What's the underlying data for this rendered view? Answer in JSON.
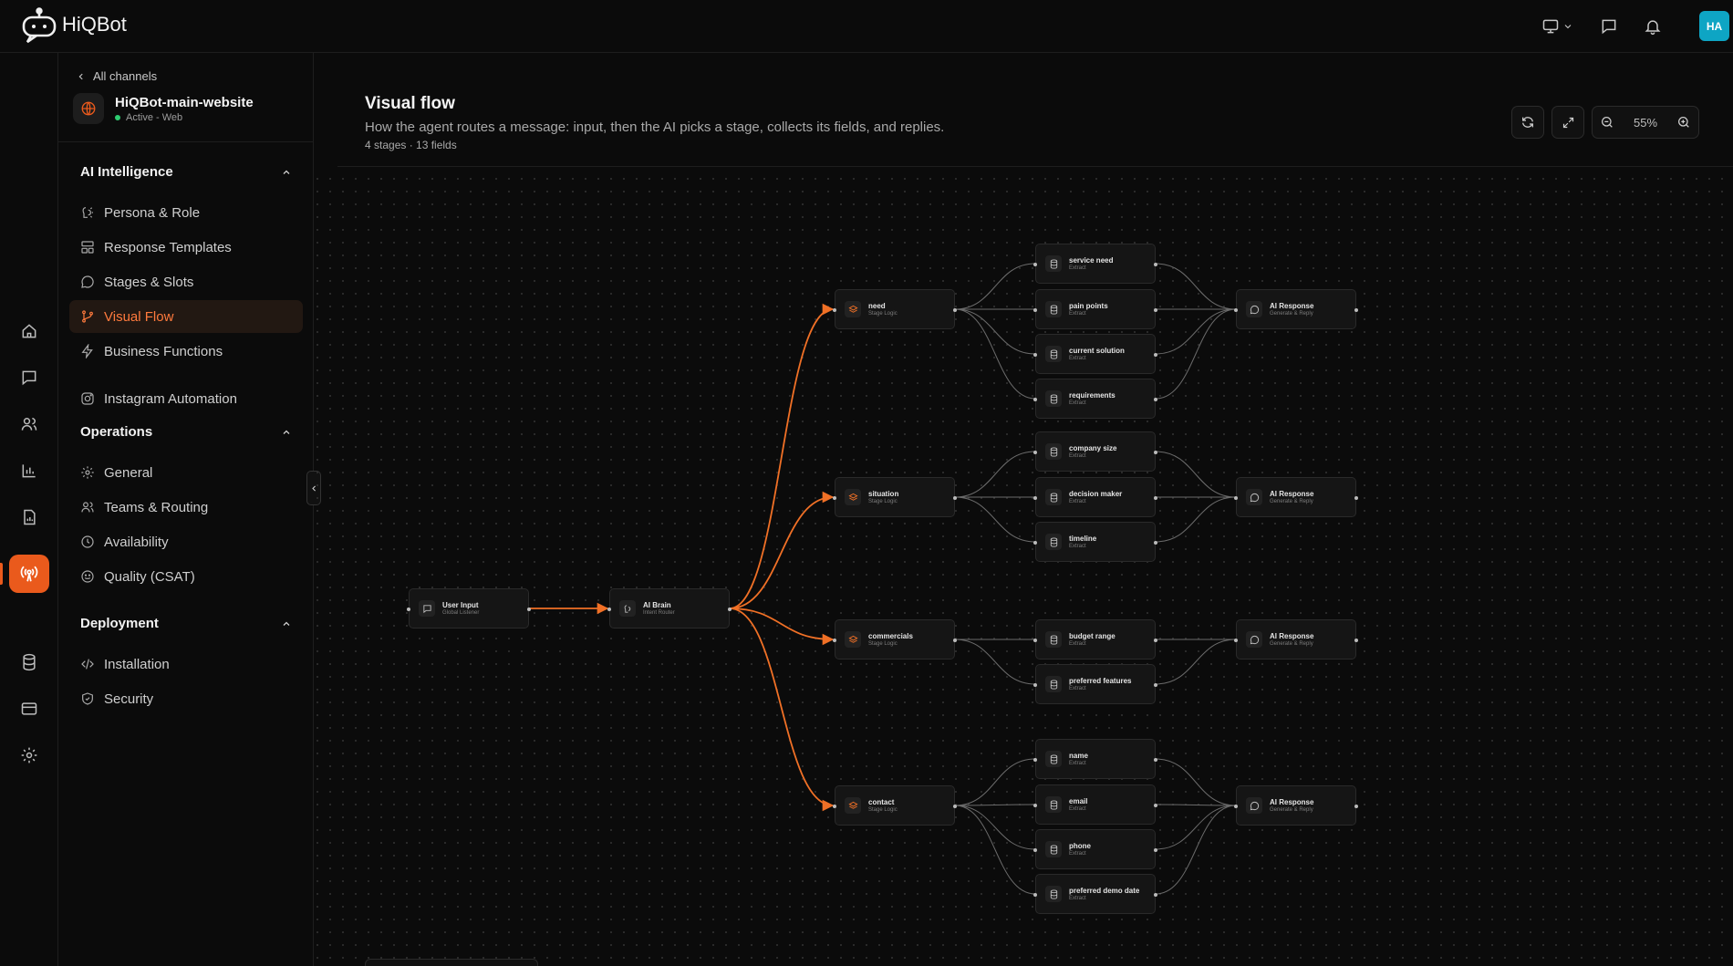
{
  "app": {
    "name": "HiQBot",
    "avatar_initials": "HA",
    "accent": "#ea5a1c",
    "avatar_color": "#0ea5c4"
  },
  "topbar": {
    "icons": [
      "monitor-icon",
      "chevron-down-icon",
      "message-icon",
      "bell-icon"
    ]
  },
  "rail": {
    "items": [
      "home-icon",
      "chat-icon",
      "users-icon",
      "bar-chart-icon",
      "report-icon",
      "broadcast-icon",
      "database-icon",
      "card-icon",
      "settings-icon"
    ],
    "active": "broadcast-icon"
  },
  "sidebar": {
    "back_label": "All channels",
    "channel": {
      "name": "HiQBot-main-website",
      "status": "Active - Web"
    },
    "sections": {
      "ai": {
        "title": "AI Intelligence",
        "items": [
          {
            "label": "Persona & Role",
            "icon": "persona-icon"
          },
          {
            "label": "Response Templates",
            "icon": "template-icon"
          },
          {
            "label": "Stages & Slots",
            "icon": "chat-bubble-icon"
          },
          {
            "label": "Visual Flow",
            "icon": "branch-icon",
            "active": true
          },
          {
            "label": "Business Functions",
            "icon": "bolt-icon"
          },
          {
            "label": "Instagram Automation",
            "icon": "instagram-icon"
          }
        ]
      },
      "operations": {
        "title": "Operations",
        "items": [
          {
            "label": "General",
            "icon": "gear-icon"
          },
          {
            "label": "Teams & Routing",
            "icon": "team-icon"
          },
          {
            "label": "Availability",
            "icon": "clock-icon"
          },
          {
            "label": "Quality (CSAT)",
            "icon": "smile-icon"
          }
        ]
      },
      "deployment": {
        "title": "Deployment",
        "items": [
          {
            "label": "Installation",
            "icon": "code-icon"
          },
          {
            "label": "Security",
            "icon": "shield-icon"
          }
        ]
      }
    }
  },
  "header": {
    "title": "Visual flow",
    "description": "How the agent routes a message: input, then the AI picks a stage, collects its fields, and replies.",
    "meta": "4 stages · 13 fields",
    "zoom": "55%"
  },
  "flow": {
    "input": {
      "title": "User Input",
      "subtitle": "Global Listener"
    },
    "brain": {
      "title": "AI Brain",
      "subtitle": "Intent Router"
    },
    "stages": [
      {
        "title": "need",
        "subtitle": "Stage Logic",
        "fields": [
          {
            "title": "service need",
            "subtitle": "Extract"
          },
          {
            "title": "pain points",
            "subtitle": "Extract"
          },
          {
            "title": "current solution",
            "subtitle": "Extract"
          },
          {
            "title": "requirements",
            "subtitle": "Extract"
          }
        ],
        "response": {
          "title": "AI Response",
          "subtitle": "Generate & Reply"
        }
      },
      {
        "title": "situation",
        "subtitle": "Stage Logic",
        "fields": [
          {
            "title": "company size",
            "subtitle": "Extract"
          },
          {
            "title": "decision maker",
            "subtitle": "Extract"
          },
          {
            "title": "timeline",
            "subtitle": "Extract"
          }
        ],
        "response": {
          "title": "AI Response",
          "subtitle": "Generate & Reply"
        }
      },
      {
        "title": "commercials",
        "subtitle": "Stage Logic",
        "fields": [
          {
            "title": "budget range",
            "subtitle": "Extract"
          },
          {
            "title": "preferred features",
            "subtitle": "Extract"
          }
        ],
        "response": {
          "title": "AI Response",
          "subtitle": "Generate & Reply"
        }
      },
      {
        "title": "contact",
        "subtitle": "Stage Logic",
        "fields": [
          {
            "title": "name",
            "subtitle": "Extract"
          },
          {
            "title": "email",
            "subtitle": "Extract"
          },
          {
            "title": "phone",
            "subtitle": "Extract"
          },
          {
            "title": "preferred demo date",
            "subtitle": "Extract"
          }
        ],
        "response": {
          "title": "AI Response",
          "subtitle": "Generate & Reply"
        }
      }
    ]
  }
}
